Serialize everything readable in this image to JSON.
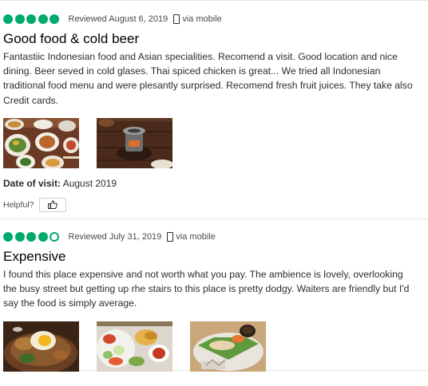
{
  "reviews": [
    {
      "rating": 5,
      "reviewed_date": "Reviewed August 6, 2019",
      "via": "via mobile",
      "title": "Good food & cold beer",
      "body": "Fantastiic Indonesian food and Asian specialities. Recomend a visit. Good location and nice dining. Beer seved in cold glases. Thai spiced chicken is great... We tried all Indonesian traditional food menu and were plesantly surprised. Recomend fresh fruit juices. They take also Credit cards.",
      "date_of_visit_label": "Date of visit:",
      "date_of_visit_value": "August 2019",
      "helpful_label": "Helpful?",
      "photos": [
        "food-platter-photo",
        "clay-pot-grill-photo"
      ]
    },
    {
      "rating": 4,
      "reviewed_date": "Reviewed July 31, 2019",
      "via": "via mobile",
      "title": "Expensive",
      "body": "I found this place expensive and not worth what you pay. The ambience is lovely, overlooking the busy street but getting up rhe stairs to this place is pretty dodgy. Waiters are friendly but I'd say the food is simply average.",
      "photos": [
        "fried-egg-rice-bowl-photo",
        "salad-plate-photo",
        "fish-banana-leaf-photo"
      ]
    }
  ],
  "colors": {
    "bubble_green": "#00aa6c",
    "text": "#2c2c2c",
    "divider": "#e6e6e6"
  },
  "icons": {
    "rating": "rating-bubble-icon",
    "mobile": "mobile-phone-icon",
    "helpful": "thumbs-up-icon"
  }
}
